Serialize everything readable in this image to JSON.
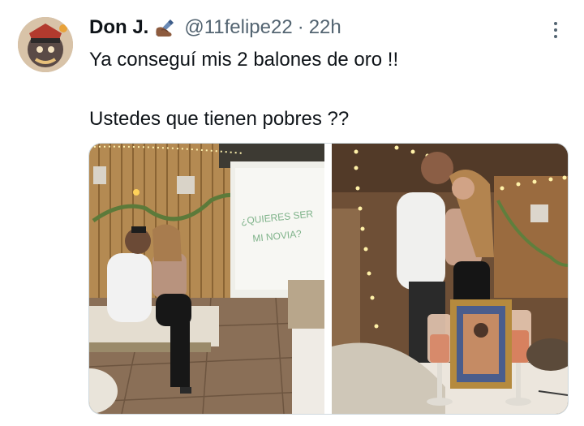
{
  "tweet": {
    "author_name": "Don J.",
    "author_badge": "writing-hand-emoji",
    "handle": "@11felipe22",
    "separator": "·",
    "timestamp": "22h",
    "text_line1": "Ya conseguí mis 2 balones de oro !!",
    "text_line2": "Ustedes que tienen pobres ??",
    "media": [
      {
        "description": "couple-kissing-in-front-of-projector-screen",
        "screen_text_line1": "¿QUIERES SER",
        "screen_text_line2": "MI NOVIA?"
      },
      {
        "description": "couple-kissing-behind-framed-photo-and-rose-glasses"
      }
    ]
  },
  "colors": {
    "text": "#0f1419",
    "secondary": "#536471",
    "border": "#cfd9de"
  }
}
